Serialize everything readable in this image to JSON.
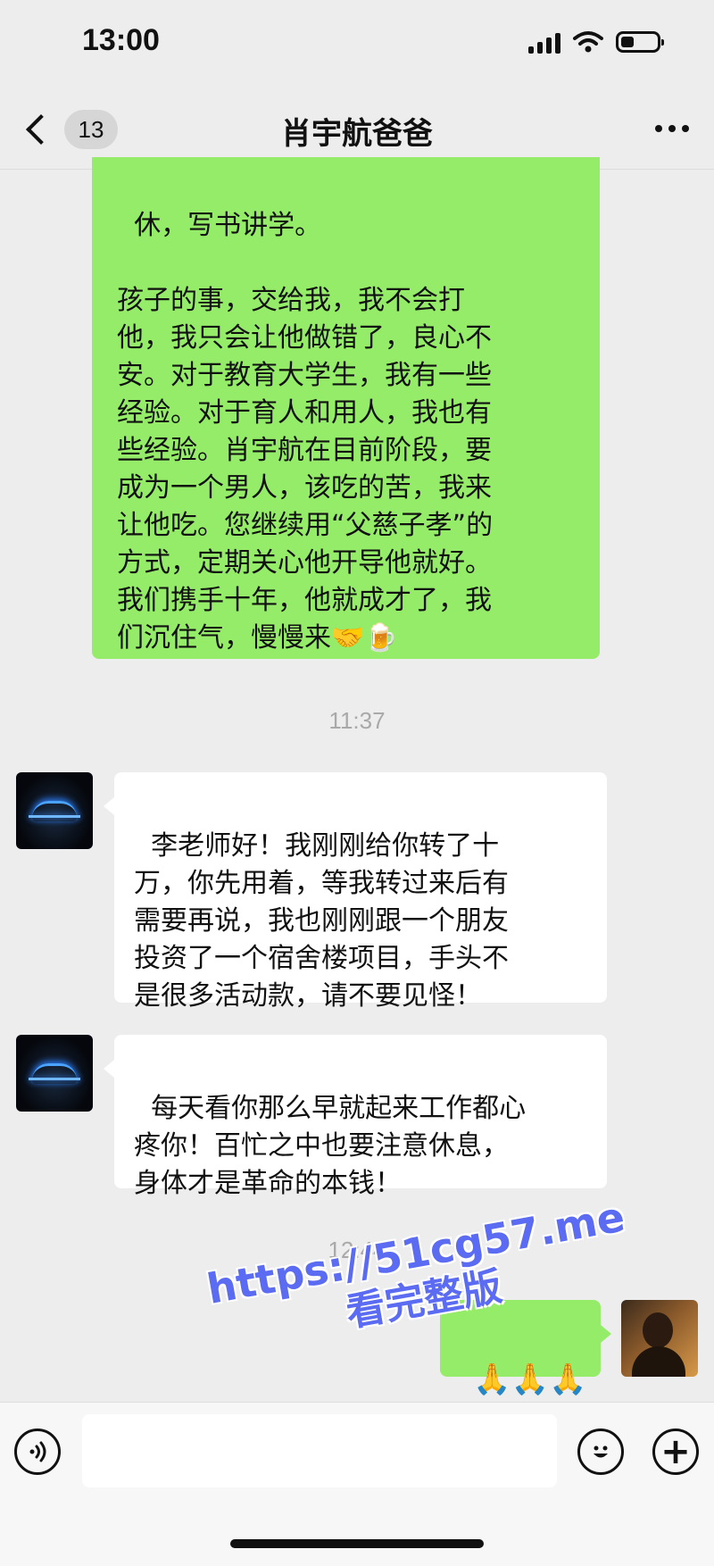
{
  "status_bar": {
    "time": "13:00"
  },
  "header": {
    "unread_count": "13",
    "title": "肖宇航爸爸"
  },
  "messages": {
    "m1": {
      "text": "休，写书讲学。\n\n孩子的事，交给我，我不会打\n他，我只会让他做错了，良心不\n安。对于教育大学生，我有一些\n经验。对于育人和用人，我也有\n些经验。肖宇航在目前阶段，要\n成为一个男人，该吃的苦，我来\n让他吃。您继续用“父慈子孝”的\n方式，定期关心他开导他就好。\n我们携手十年，他就成才了，我\n们沉住气，慢慢来🤝🍺"
    },
    "t1": "11:37",
    "m2": {
      "text": "李老师好！我刚刚给你转了十\n万，你先用着，等我转过来后有\n需要再说，我也刚刚跟一个朋友\n投资了一个宿舍楼项目，手头不\n是很多活动款，请不要见怪！"
    },
    "m3": {
      "text": "每天看你那么早就起来工作都心\n疼你！百忙之中也要注意休息，\n身体才是革命的本钱！"
    },
    "t2": "12:44",
    "m4": {
      "text": "🙏🙏🙏"
    }
  },
  "watermark": {
    "url": "https://51cg57.me",
    "text": "看完整版"
  },
  "input_bar": {
    "plus": "+"
  },
  "colors": {
    "bubble_green": "#95ec69",
    "bubble_white": "#ffffff",
    "background": "#ededed",
    "watermark": "#5b6cf2"
  }
}
